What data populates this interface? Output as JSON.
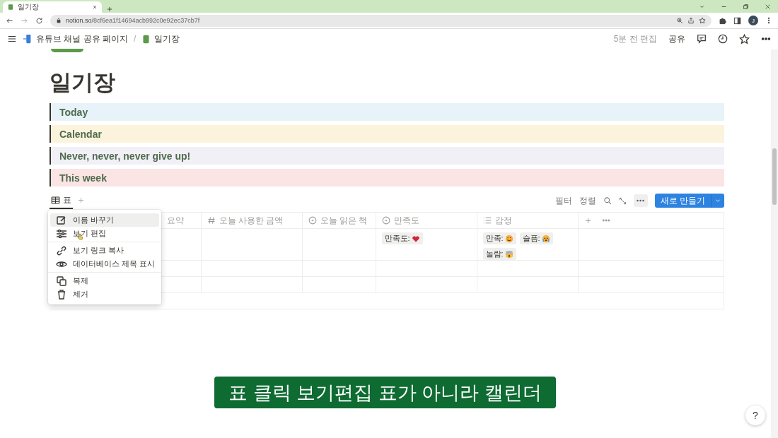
{
  "browser": {
    "tab_title": "일기장",
    "url_host": "notion.so",
    "url_path": "/8cf6ea1f14694acb992c0e92ec37cb7f",
    "profile_initial": "J"
  },
  "topbar": {
    "breadcrumbs": [
      "유튜브 채널 공유 페이지",
      "일기장"
    ],
    "separator": "/",
    "edited": "5분 전 편집",
    "share": "공유"
  },
  "page": {
    "title": "일기장",
    "callouts": [
      {
        "text": "Today",
        "color": "#e7f3f8"
      },
      {
        "text": "Calendar",
        "color": "#fbf3db"
      },
      {
        "text": "Never, never, never give up!",
        "color": "#f1f0f7"
      },
      {
        "text": "This week",
        "color": "#fbe4e4"
      }
    ]
  },
  "database": {
    "views": [
      {
        "label": "표",
        "selected": true
      }
    ],
    "toolbar": {
      "filter": "필터",
      "sort": "정렬",
      "new_button": "새로 만들기"
    },
    "columns": [
      {
        "kind": "text",
        "label": "요약"
      },
      {
        "kind": "number",
        "label": "오늘 사용한 금액"
      },
      {
        "kind": "select",
        "label": "오늘 읽은 책"
      },
      {
        "kind": "select",
        "label": "만족도"
      },
      {
        "kind": "multi",
        "label": "감정"
      }
    ],
    "rows": [
      {
        "cells": [
          [],
          [],
          [],
          [
            {
              "label": "만족도:",
              "kind": "heart"
            }
          ],
          [
            {
              "label": "만족:",
              "kind": "star-eyes"
            },
            {
              "label": "슬픔:",
              "kind": "crying"
            },
            {
              "label": "놀람:",
              "kind": "scream"
            }
          ]
        ]
      },
      {
        "cells": [
          [],
          [],
          [],
          [],
          []
        ]
      },
      {
        "cells": [
          [],
          [],
          [],
          [],
          []
        ]
      }
    ]
  },
  "menu": {
    "groups": [
      [
        {
          "kind": "rename",
          "label": "이름 바꾸기",
          "selected": true
        },
        {
          "kind": "edit",
          "label": "보기 편집",
          "selected": false
        }
      ],
      [
        {
          "kind": "link",
          "label": "보기 링크 복사",
          "selected": false
        },
        {
          "kind": "eye",
          "label": "데이터베이스 제목 표시",
          "selected": false
        }
      ],
      [
        {
          "kind": "duplicate",
          "label": "복제",
          "selected": false
        },
        {
          "kind": "trash",
          "label": "제거",
          "selected": false
        }
      ]
    ]
  },
  "caption": "표 클릭 보기편집 표가 아니라 캘린더",
  "help": "?"
}
